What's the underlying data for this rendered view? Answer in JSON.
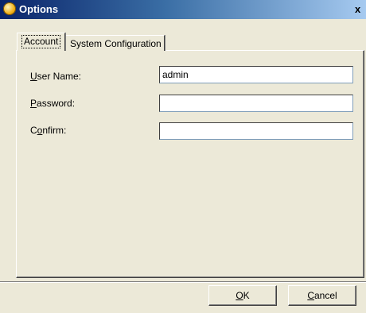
{
  "window": {
    "title": "Options",
    "close_glyph": "x"
  },
  "tabs": [
    {
      "label": "Account",
      "active": true
    },
    {
      "label": "System Configuration",
      "active": false
    }
  ],
  "form": {
    "username": {
      "label_first": "U",
      "label_rest": "ser Name:",
      "value": "admin"
    },
    "password": {
      "label_first": "P",
      "label_rest": "assword:",
      "value": ""
    },
    "confirm": {
      "label_first": "C",
      "label_mid": "o",
      "label_rest": "nfirm:",
      "value": ""
    }
  },
  "buttons": {
    "ok": {
      "label_first": "O",
      "label_rest": "K"
    },
    "cancel": {
      "label_first": "C",
      "label_rest": "ancel"
    }
  },
  "colors": {
    "titlebar_start": "#0a246a",
    "dialog_bg": "#ece9d8"
  }
}
